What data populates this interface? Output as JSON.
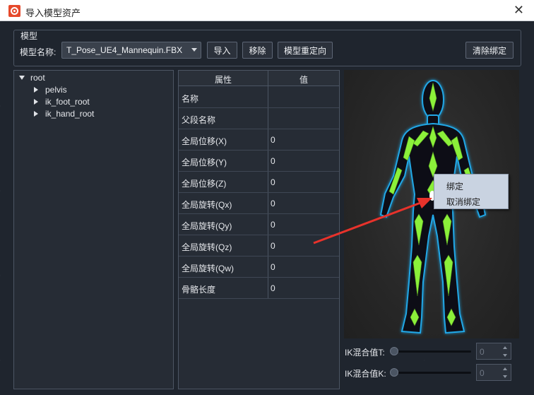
{
  "window": {
    "title": "导入模型资产",
    "close_icon": "close-icon"
  },
  "model_group": {
    "label": "模型",
    "name_label": "模型名称:",
    "selected_model": "T_Pose_UE4_Mannequin.FBX",
    "import_label": "导入",
    "remove_label": "移除",
    "retarget_label": "模型重定向",
    "clear_binding_label": "清除绑定"
  },
  "tree": {
    "items": [
      {
        "label": "root",
        "expanded": true
      },
      {
        "label": "pelvis",
        "expanded": false
      },
      {
        "label": "ik_foot_root",
        "expanded": false
      },
      {
        "label": "ik_hand_root",
        "expanded": false
      }
    ]
  },
  "properties": {
    "col_name": "属性",
    "col_value": "值",
    "rows": [
      {
        "name": "名称",
        "value": ""
      },
      {
        "name": "父段名称",
        "value": ""
      },
      {
        "name": "全局位移(X)",
        "value": "0"
      },
      {
        "name": "全局位移(Y)",
        "value": "0"
      },
      {
        "name": "全局位移(Z)",
        "value": "0"
      },
      {
        "name": "全局旋转(Qx)",
        "value": "0"
      },
      {
        "name": "全局旋转(Qy)",
        "value": "0"
      },
      {
        "name": "全局旋转(Qz)",
        "value": "0"
      },
      {
        "name": "全局旋转(Qw)",
        "value": "0"
      },
      {
        "name": "骨骼长度",
        "value": "0"
      }
    ]
  },
  "context_menu": {
    "items": [
      "绑定",
      "取消绑定"
    ]
  },
  "ik": {
    "blend_t_label": "IK混合值T:",
    "blend_t_value": "0",
    "blend_k_label": "IK混合值K:",
    "blend_k_value": "0"
  },
  "colors": {
    "bone": "#8bf03a",
    "body_outline": "#21a7e6",
    "arrow": "#e8322b"
  }
}
